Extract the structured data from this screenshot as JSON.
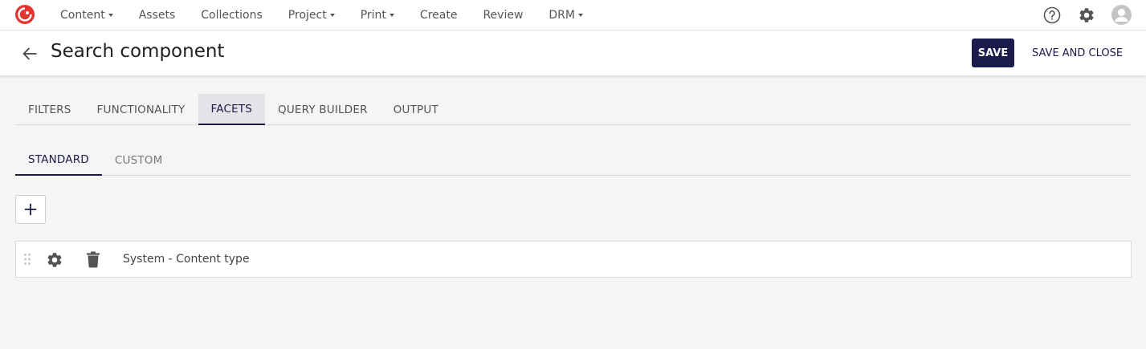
{
  "nav": {
    "items": [
      {
        "label": "Content",
        "dropdown": true
      },
      {
        "label": "Assets",
        "dropdown": false
      },
      {
        "label": "Collections",
        "dropdown": false
      },
      {
        "label": "Project",
        "dropdown": true
      },
      {
        "label": "Print",
        "dropdown": true
      },
      {
        "label": "Create",
        "dropdown": false
      },
      {
        "label": "Review",
        "dropdown": false
      },
      {
        "label": "DRM",
        "dropdown": true
      }
    ],
    "icons": [
      "help-icon",
      "gear-icon",
      "avatar-icon"
    ]
  },
  "header": {
    "title": "Search component",
    "save_label": "SAVE",
    "save_close_label": "SAVE AND CLOSE"
  },
  "tabs": [
    {
      "label": "FILTERS",
      "active": false
    },
    {
      "label": "FUNCTIONALITY",
      "active": false
    },
    {
      "label": "FACETS",
      "active": true
    },
    {
      "label": "QUERY BUILDER",
      "active": false
    },
    {
      "label": "OUTPUT",
      "active": false
    }
  ],
  "subtabs": [
    {
      "label": "STANDARD",
      "active": true
    },
    {
      "label": "CUSTOM",
      "active": false
    }
  ],
  "facets": [
    {
      "label": "System - Content type"
    }
  ],
  "colors": {
    "accent": "#1b1b4b",
    "logo": "#e3342f",
    "background": "#f5f5f5"
  }
}
